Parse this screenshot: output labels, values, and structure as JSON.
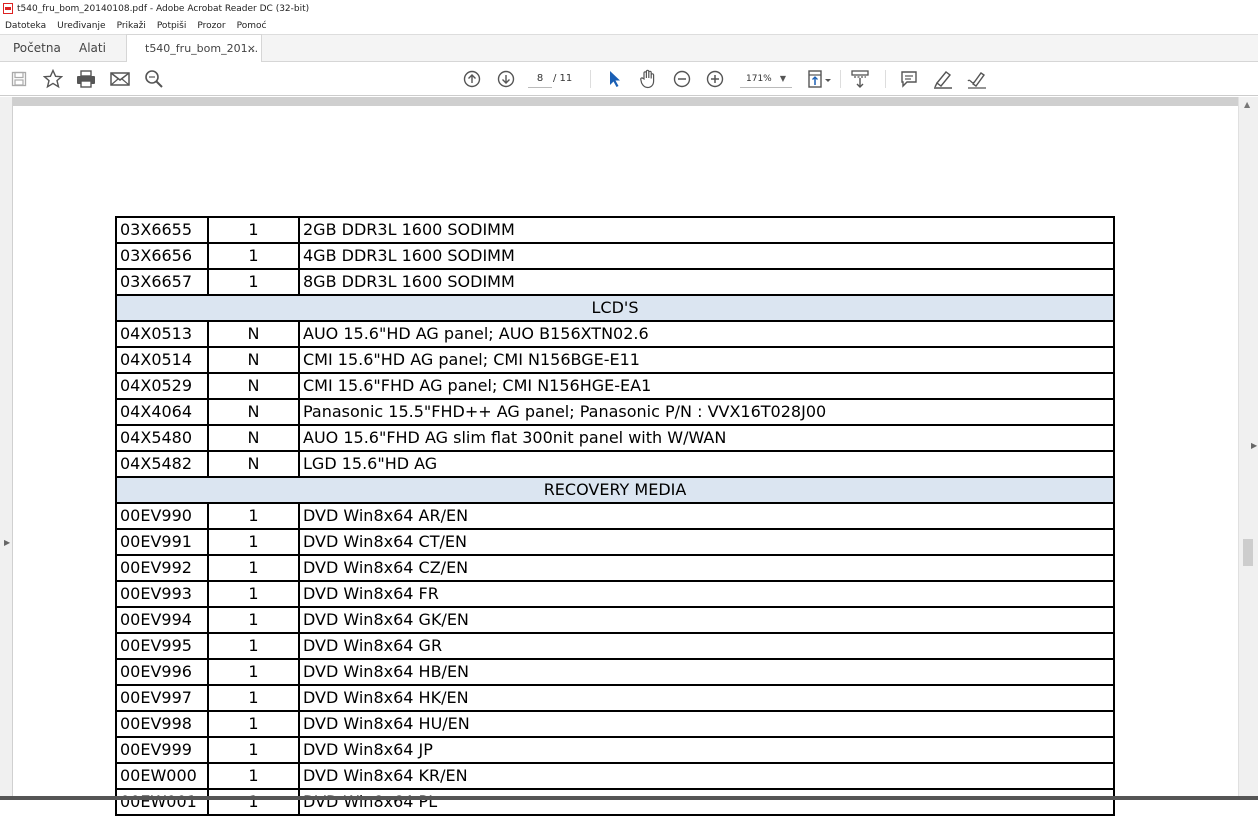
{
  "window": {
    "title": "t540_fru_bom_20140108.pdf - Adobe Acrobat Reader DC (32-bit)"
  },
  "menu": [
    "Datoteka",
    "Uređivanje",
    "Prikaži",
    "Potpiši",
    "Prozor",
    "Pomoć"
  ],
  "tabs": {
    "home": "Početna",
    "tools": "Alati",
    "document": "t540_fru_bom_201...",
    "close": "×"
  },
  "toolbar": {
    "page_current": "8",
    "page_total": "/ 11",
    "zoom": "171%",
    "left_icons": [
      "save-icon",
      "bookmark-star-icon",
      "print-icon",
      "email-icon",
      "search-zoom-icon"
    ],
    "center_icons": [
      "page-up-icon",
      "page-down-icon",
      "select-cursor-icon",
      "hand-icon",
      "zoom-out-icon",
      "zoom-in-icon",
      "fit-page-icon",
      "scroll-mode-icon"
    ],
    "right_icons": [
      "comment-icon",
      "highlight-icon",
      "sign-icon"
    ]
  },
  "table": {
    "rows": [
      {
        "type": "item",
        "part": "03X6655",
        "qty": "1",
        "desc": "2GB DDR3L 1600 SODIMM"
      },
      {
        "type": "item",
        "part": "03X6656",
        "qty": "1",
        "desc": "4GB DDR3L 1600 SODIMM"
      },
      {
        "type": "item",
        "part": "03X6657",
        "qty": "1",
        "desc": "8GB DDR3L 1600 SODIMM"
      },
      {
        "type": "section",
        "label": "LCD'S"
      },
      {
        "type": "item",
        "part": "04X0513",
        "qty": "N",
        "desc": "AUO 15.6\"HD AG panel; AUO B156XTN02.6"
      },
      {
        "type": "item",
        "part": "04X0514",
        "qty": "N",
        "desc": "CMI 15.6\"HD AG panel; CMI N156BGE-E11"
      },
      {
        "type": "item",
        "part": "04X0529",
        "qty": "N",
        "desc": "CMI 15.6\"FHD AG panel; CMI N156HGE-EA1"
      },
      {
        "type": "item",
        "part": "04X4064",
        "qty": "N",
        "desc": "Panasonic 15.5\"FHD++ AG panel; Panasonic P/N : VVX16T028J00"
      },
      {
        "type": "item",
        "part": "04X5480",
        "qty": "N",
        "desc": "AUO 15.6\"FHD AG slim flat 300nit panel with W/WAN"
      },
      {
        "type": "item",
        "part": "04X5482",
        "qty": "N",
        "desc": "LGD 15.6\"HD AG"
      },
      {
        "type": "section",
        "label": "RECOVERY MEDIA"
      },
      {
        "type": "item",
        "part": "00EV990",
        "qty": "1",
        "desc": "DVD Win8x64 AR/EN"
      },
      {
        "type": "item",
        "part": "00EV991",
        "qty": "1",
        "desc": "DVD Win8x64 CT/EN"
      },
      {
        "type": "item",
        "part": "00EV992",
        "qty": "1",
        "desc": "DVD Win8x64 CZ/EN"
      },
      {
        "type": "item",
        "part": "00EV993",
        "qty": "1",
        "desc": "DVD Win8x64 FR"
      },
      {
        "type": "item",
        "part": "00EV994",
        "qty": "1",
        "desc": "DVD Win8x64 GK/EN"
      },
      {
        "type": "item",
        "part": "00EV995",
        "qty": "1",
        "desc": "DVD Win8x64 GR"
      },
      {
        "type": "item",
        "part": "00EV996",
        "qty": "1",
        "desc": "DVD Win8x64 HB/EN"
      },
      {
        "type": "item",
        "part": "00EV997",
        "qty": "1",
        "desc": "DVD Win8x64 HK/EN"
      },
      {
        "type": "item",
        "part": "00EV998",
        "qty": "1",
        "desc": "DVD Win8x64 HU/EN"
      },
      {
        "type": "item",
        "part": "00EV999",
        "qty": "1",
        "desc": "DVD Win8x64 JP"
      },
      {
        "type": "item",
        "part": "00EW000",
        "qty": "1",
        "desc": "DVD Win8x64 KR/EN"
      },
      {
        "type": "item",
        "part": "00EW001",
        "qty": "1",
        "desc": "DVD Win8x64 PL"
      }
    ]
  },
  "colors": {
    "section_fill": "#dbe5f1",
    "icon": "#555555",
    "selected_tool": "#1a5fb4"
  }
}
